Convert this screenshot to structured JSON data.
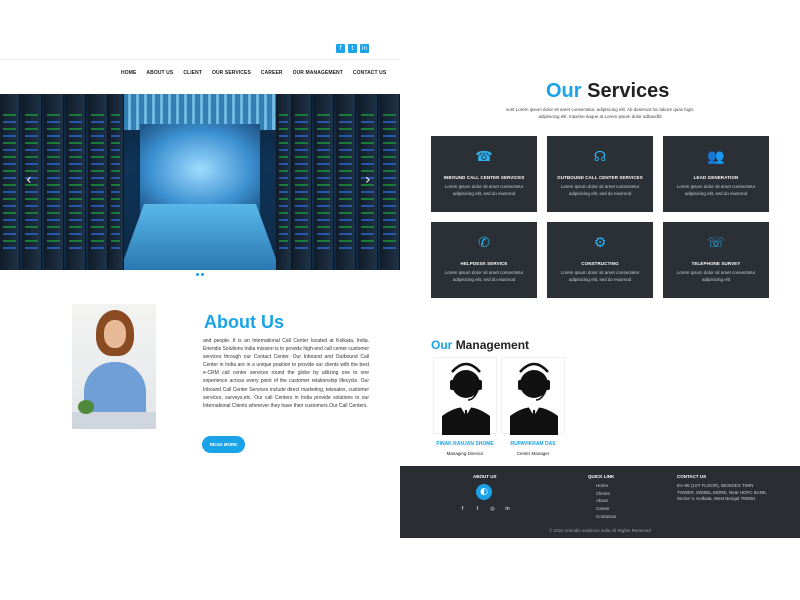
{
  "header": {
    "social": [
      "f",
      "t",
      "in"
    ],
    "nav": [
      "HOME",
      "ABOUT US",
      "CLIENT",
      "OUR SERVICES",
      "CAREER",
      "OUR MANAGEMENT",
      "CONTACT US"
    ]
  },
  "hero": {
    "prev_arrow": "‹",
    "next_arrow": "›"
  },
  "about": {
    "title": "About Us",
    "text": "and people. It is an International Call Center located at Kolkata, India. Eriendis Solutions India mission is to provide high-end call center customer services through our Contact Center. Our Inbound and Outbound Call Center in India are in a unique position to provide our clients with the best e-CRM call center services round the globe by utilizing one to one experience across every point of the customer relationship lifecycle. Our Inbound Call Center Services include direct marketing, telesales, customer services, surveys,etc. Our call Centers in India provide solutions to our International Clients wherever they have their customers.Our Call Centers.",
    "button": "READ MORE"
  },
  "services": {
    "title_a": "Our",
    "title_b": "Services",
    "subtitle": "sunt Lorem ipsum dolor sit amet consectetur, adipisicing elit. Ab deserunt hic labore quas fugit, adipisicing elit. maxime itaque at Lorem ipsum dolor adbavdfd",
    "cards": [
      {
        "icon": "headset-icon",
        "glyph": "☎",
        "title": "INBOUND CALL CENTER SERVICES",
        "desc": "Lorem ipsum dolor sit amet consectetur adipisicing elit, sed do eiusmod"
      },
      {
        "icon": "headphones-icon",
        "glyph": "☊",
        "title": "OUTBOUND CALL CENTER SERVICES",
        "desc": "Lorem ipsum dolor sit amet consectetur adipisicing elit, sed do eiusmod"
      },
      {
        "icon": "users-icon",
        "glyph": "👥",
        "title": "LEAD GENERATION",
        "desc": "Lorem ipsum dolor sit amet consectetur adipisicing elit, sed do eiusmod"
      },
      {
        "icon": "phone-icon",
        "glyph": "✆",
        "title": "HELPDESK SERVICE",
        "desc": "Lorem ipsum dolor sit amet consectetur adipisicing elit, sed do eiusmod"
      },
      {
        "icon": "gear-icon",
        "glyph": "⚙",
        "title": "CONSTRUCTING",
        "desc": "Lorem ipsum dolor sit amet consectetur adipisicing elit, sed do eiusmod"
      },
      {
        "icon": "support-agent-icon",
        "glyph": "☏",
        "title": "TELEPHONE SURVEY",
        "desc": "Lorem ipsum dolor sit amet consectetur adipisicing elit"
      }
    ]
  },
  "management": {
    "title_a": "Our",
    "title_b": "Management",
    "people": [
      {
        "name": "PINAK RANJAN SHOME",
        "role": "Managing Director"
      },
      {
        "name": "RUPAVIKRAM DAS",
        "role": "Center Manager"
      }
    ]
  },
  "footer": {
    "about_head": "ABOUT US",
    "logo_glyph": "◐",
    "social": [
      "f",
      "t",
      "◎",
      "in"
    ],
    "quick_head": "QUICK LINK",
    "quick_links": [
      "Home",
      "Clients",
      "About",
      "Career",
      "Contactus"
    ],
    "contact_head": "CONTACT US",
    "address": "EA-96 (1ST FLOOR), BESIDES TWIN TOWER, WEBEL MORE, Near HDFC BANK, Sector V, Kolkata, West Bengal 700091",
    "copyright": "© 2022 eriendis solutions india All Rights Reserved"
  }
}
